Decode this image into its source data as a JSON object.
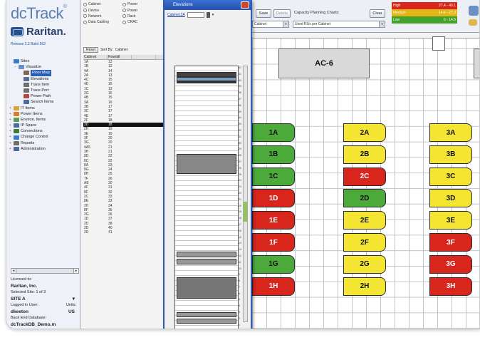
{
  "app": {
    "logo_text": "dcTrack",
    "logo_mark": "®",
    "brand": "Raritan.",
    "release": "Release 2.2 Build 563"
  },
  "tree": [
    {
      "label": "Sites",
      "exp": "",
      "color": "#3a7bd5",
      "sel": false,
      "indent": 0
    },
    {
      "label": "Visualize",
      "exp": "−",
      "color": "#6a8fc8",
      "sel": false,
      "indent": 1
    },
    {
      "label": "Floor Map",
      "exp": "",
      "color": "#7d6a4c",
      "sel": true,
      "indent": 2
    },
    {
      "label": "Elevations",
      "exp": "",
      "color": "#5a6f8f",
      "sel": false,
      "indent": 2
    },
    {
      "label": "Trace Item",
      "exp": "",
      "color": "#6f6f6f",
      "sel": false,
      "indent": 2
    },
    {
      "label": "Trace Port",
      "exp": "",
      "color": "#6f6f6f",
      "sel": false,
      "indent": 2
    },
    {
      "label": "Power Path",
      "exp": "",
      "color": "#b54a3a",
      "sel": false,
      "indent": 2
    },
    {
      "label": "Search Items",
      "exp": "",
      "color": "#4c6a9e",
      "sel": false,
      "indent": 2
    },
    {
      "label": "IT Items",
      "exp": "+",
      "color": "#d9a531",
      "sel": false,
      "indent": 0
    },
    {
      "label": "Power Items",
      "exp": "+",
      "color": "#d97f2a",
      "sel": false,
      "indent": 0
    },
    {
      "label": "Environ. Items",
      "exp": "+",
      "color": "#5aa04a",
      "sel": false,
      "indent": 0
    },
    {
      "label": "IP Space",
      "exp": "+",
      "color": "#4c6a9e",
      "sel": false,
      "indent": 0
    },
    {
      "label": "Connections",
      "exp": "+",
      "color": "#3c7f3c",
      "sel": false,
      "indent": 0
    },
    {
      "label": "Change Control",
      "exp": "+",
      "color": "#3a7bd5",
      "sel": false,
      "indent": 0
    },
    {
      "label": "Reports",
      "exp": "+",
      "color": "#6f6f6f",
      "sel": false,
      "indent": 0
    },
    {
      "label": "Administration",
      "exp": "+",
      "color": "#4c6a9e",
      "sel": false,
      "indent": 0
    }
  ],
  "info": {
    "l1": "Licensed to:",
    "l2": "Raritan, Inc.",
    "l3": "Selected Site: 1 of 3",
    "l4a": "SITE A",
    "l4b": "▾",
    "l5a": "Logged in User:",
    "l5b": "Units:",
    "l6a": "dkeeton",
    "l6b": "US",
    "l7": "Back End Database:",
    "l8": "dcTrackDB_Demo.m"
  },
  "radios": [
    [
      "Cabinet",
      "Power"
    ],
    [
      "Device",
      "Power"
    ],
    [
      "Network",
      "Rack"
    ],
    [
      "Data Cabling",
      "CRAC"
    ]
  ],
  "sort": {
    "reset": "Reset",
    "label": "Sort By:",
    "value": "Cabinet"
  },
  "grid": {
    "headers": [
      "Cabinet",
      "Row/all",
      ""
    ],
    "rows": [
      [
        "1A",
        "12"
      ],
      [
        "1B",
        "12"
      ],
      [
        "4A",
        "14"
      ],
      [
        "2A",
        "13"
      ],
      [
        "4C",
        "15"
      ],
      [
        "4D",
        "15"
      ],
      [
        "1C",
        "13"
      ],
      [
        "2G",
        "16"
      ],
      [
        "4B",
        "15"
      ],
      [
        "3A",
        "16"
      ],
      [
        "3B",
        "17"
      ],
      [
        "3C",
        "17"
      ],
      [
        "4E",
        "17"
      ],
      [
        "2F",
        "18"
      ],
      [
        "3D",
        "18"
      ],
      [
        "2H",
        "19"
      ],
      [
        "3E",
        "19"
      ],
      [
        "3F",
        "20"
      ],
      [
        "3G",
        "20"
      ],
      [
        "4A5",
        "21"
      ],
      [
        "3H",
        "21"
      ],
      [
        "8D",
        "22"
      ],
      [
        "8C",
        "22"
      ],
      [
        "8A",
        "23"
      ],
      [
        "8G",
        "24"
      ],
      [
        "8H",
        "25"
      ],
      [
        "7F",
        "26"
      ],
      [
        "AE",
        "30"
      ],
      [
        "4F",
        "31"
      ],
      [
        "8F",
        "32"
      ],
      [
        "2C",
        "33"
      ],
      [
        "8E",
        "33"
      ],
      [
        "2H",
        "34"
      ],
      [
        "8F",
        "35"
      ],
      [
        "2G",
        "36"
      ],
      [
        "1D",
        "37"
      ],
      [
        "2D",
        "38"
      ],
      [
        "2D",
        "40"
      ],
      [
        "2D",
        "41"
      ]
    ],
    "selected_row": 14
  },
  "elevation": {
    "title": "Elevations",
    "cabinet_link": "Cabinet:2A",
    "ru_numbers": [
      "42",
      "41",
      "40",
      "39",
      "38",
      "37",
      "36",
      "35",
      "34",
      "33",
      "32",
      "31",
      "30",
      "29",
      "28",
      "27",
      "26",
      "25",
      "24",
      "23",
      "22",
      "21",
      "20",
      "19",
      "18",
      "17",
      "16",
      "15",
      "14",
      "13",
      "12",
      "11",
      "10",
      "9",
      "8",
      "7",
      "6",
      "5",
      "4",
      "3",
      "2",
      "1"
    ]
  },
  "toolbar": {
    "save": "Save",
    "delete": "Delete",
    "capacity_label": "Capacity Planning Charts:",
    "clear": "Clear",
    "select_left": "Cabinet",
    "select_right": "Used RUs per Cabinet",
    "legend": [
      {
        "label": "High",
        "range": "27.4 - 40.1",
        "color": "#d8261c"
      },
      {
        "label": "Medium",
        "range": "14.6 - 27.3",
        "color": "#e2b614"
      },
      {
        "label": "Low",
        "range": "0 - 14.5",
        "color": "#43a22b"
      }
    ]
  },
  "map": {
    "ac_label": "AC-6",
    "cabinets": [
      {
        "label": "1A",
        "color": "green",
        "col": 0,
        "row": 0
      },
      {
        "label": "1B",
        "color": "green",
        "col": 0,
        "row": 1
      },
      {
        "label": "1C",
        "color": "green",
        "col": 0,
        "row": 2
      },
      {
        "label": "1D",
        "color": "red",
        "col": 0,
        "row": 3
      },
      {
        "label": "1E",
        "color": "red",
        "col": 0,
        "row": 4
      },
      {
        "label": "1F",
        "color": "red",
        "col": 0,
        "row": 5
      },
      {
        "label": "1G",
        "color": "green",
        "col": 0,
        "row": 6
      },
      {
        "label": "1H",
        "color": "red",
        "col": 0,
        "row": 7
      },
      {
        "label": "2A",
        "color": "yellow",
        "col": 1,
        "row": 0
      },
      {
        "label": "2B",
        "color": "yellow",
        "col": 1,
        "row": 1
      },
      {
        "label": "2C",
        "color": "red",
        "col": 1,
        "row": 2
      },
      {
        "label": "2D",
        "color": "green",
        "col": 1,
        "row": 3
      },
      {
        "label": "2E",
        "color": "yellow",
        "col": 1,
        "row": 4
      },
      {
        "label": "2F",
        "color": "yellow",
        "col": 1,
        "row": 5
      },
      {
        "label": "2G",
        "color": "yellow",
        "col": 1,
        "row": 6
      },
      {
        "label": "2H",
        "color": "yellow",
        "col": 1,
        "row": 7
      },
      {
        "label": "3A",
        "color": "yellow",
        "col": 2,
        "row": 0
      },
      {
        "label": "3B",
        "color": "yellow",
        "col": 2,
        "row": 1
      },
      {
        "label": "3C",
        "color": "yellow",
        "col": 2,
        "row": 2
      },
      {
        "label": "3D",
        "color": "yellow",
        "col": 2,
        "row": 3
      },
      {
        "label": "3E",
        "color": "yellow",
        "col": 2,
        "row": 4
      },
      {
        "label": "3F",
        "color": "red",
        "col": 2,
        "row": 5
      },
      {
        "label": "3G",
        "color": "red",
        "col": 2,
        "row": 6
      },
      {
        "label": "3H",
        "color": "red",
        "col": 2,
        "row": 7
      }
    ],
    "colors": {
      "green": "#4caa3a",
      "yellow": "#f3e531",
      "red": "#d8261c"
    }
  }
}
